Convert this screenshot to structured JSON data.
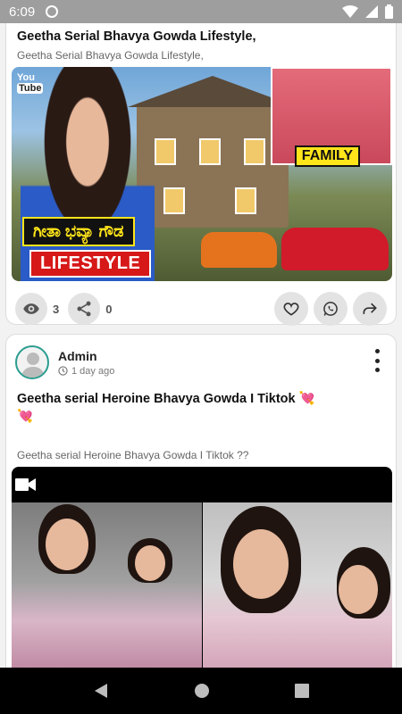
{
  "status_bar": {
    "time": "6:09"
  },
  "posts": [
    {
      "title": "Geetha Serial Bhavya Gowda Lifestyle,",
      "subtitle": "Geetha Serial Bhavya Gowda Lifestyle,",
      "thumbnail": {
        "youtube_top": "You",
        "youtube_bottom": "Tube",
        "kannada_text": "ಗೀತಾ ಭವ್ಯಾ ಗೌಡ",
        "lifestyle_text": "LIFESTYLE",
        "family_text": "FAMILY"
      },
      "views": "3",
      "shares": "0"
    },
    {
      "author": "Admin",
      "time_ago": "1 day ago",
      "title": "Geetha serial Heroine Bhavya Gowda I Tiktok",
      "title_emoji": "💘",
      "title_emoji_line2": "💘",
      "subtitle": "Geetha serial Heroine Bhavya Gowda I Tiktok ??"
    }
  ],
  "colors": {
    "accent": "#2a9d8f",
    "lifestyle_red": "#d71818",
    "family_yellow": "#ffe51a"
  }
}
